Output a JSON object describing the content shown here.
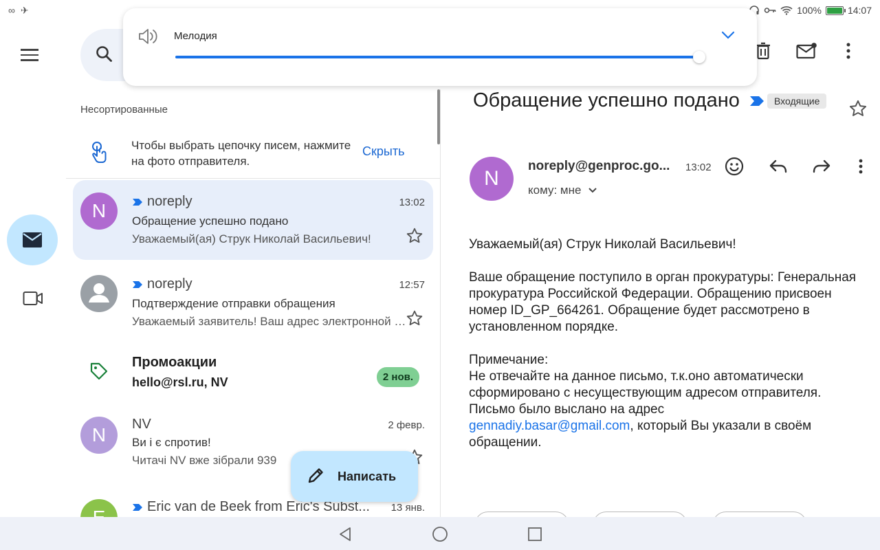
{
  "status_bar": {
    "left_icons": "∞ ✈",
    "battery_level": "100%",
    "time": "14:07",
    "battery_fraction": 1.0
  },
  "volume_popup": {
    "label": "Мелодия",
    "level_fraction": 0.995
  },
  "list": {
    "section_label": "Несортированные",
    "tip_text": "Чтобы выбрать цепочку писем, нажмите на фото отправителя.",
    "tip_action": "Скрыть",
    "items": [
      {
        "avatar_letter": "N",
        "avatar_color": "#b06ad0",
        "sender": "noreply",
        "time": "13:02",
        "subject": "Обращение успешно подано",
        "snippet": "Уважаемый(ая) Струк Николай Васильевич!"
      },
      {
        "sender": "noreply",
        "time": "12:57",
        "subject": "Подтверждение отправки обращения",
        "snippet": "Уважаемый заявитель! Ваш адрес электронной почты"
      },
      {
        "title": "Промоакции",
        "senders": "hello@rsl.ru, NV",
        "badge": "2 нов.",
        "badge_color": "#7fcf93"
      },
      {
        "avatar_letter": "N",
        "avatar_color": "#b39ddb",
        "sender": "NV",
        "time": "2 февр.",
        "subject": "Ви і є спротив!",
        "snippet": "Читачі NV вже зібрали 939"
      },
      {
        "avatar_letter": "E",
        "avatar_color": "#8bc34a",
        "sender": "Eric van de Beek from Eric's Subst...",
        "time": "13 янв."
      }
    ],
    "compose_label": "Написать"
  },
  "message": {
    "title": "Обращение успешно подано",
    "label_chip": "Входящие",
    "avatar_letter": "N",
    "from": "noreply@genproc.go...",
    "time": "13:02",
    "to": "кому: мне",
    "greeting": "Уважаемый(ая) Струк Николай Васильевич!",
    "paragraph1": "Ваше обращение поступило в орган прокуратуры: Генеральная прокуратура Российской Федерации. Обращению присвоен номер ID_GP_664261. Обращение будет рассмотрено в установленном порядке.",
    "note_heading": "Примечание:",
    "note_line": "Не отвечайте на данное письмо, т.к.оно автоматически сформировано с несуществующим адресом отправителя.",
    "sent_to_prefix": "Письмо было выслано на адрес",
    "email_link": "gennadiy.basar@gmail.com",
    "sent_to_suffix": ", который Вы указали в своём обращении."
  },
  "colors": {
    "accent": "#1a73e8",
    "rail_active": "#c2e7ff",
    "selected_row": "#e7eefa",
    "important_marker": "#1a73e8"
  },
  "icons": {
    "menu": "hamburger-icon",
    "search": "search-icon",
    "volume": "speaker-icon",
    "delete": "trash-icon",
    "mark_unread": "mail-unread-icon",
    "more": "more-vert-icon",
    "mail": "mail-icon",
    "video": "video-icon",
    "touch": "touch-icon",
    "tag": "tag-icon",
    "star": "star-icon",
    "emoji": "emoji-icon",
    "reply": "reply-icon",
    "forward": "forward-icon",
    "edit": "pencil-icon"
  }
}
